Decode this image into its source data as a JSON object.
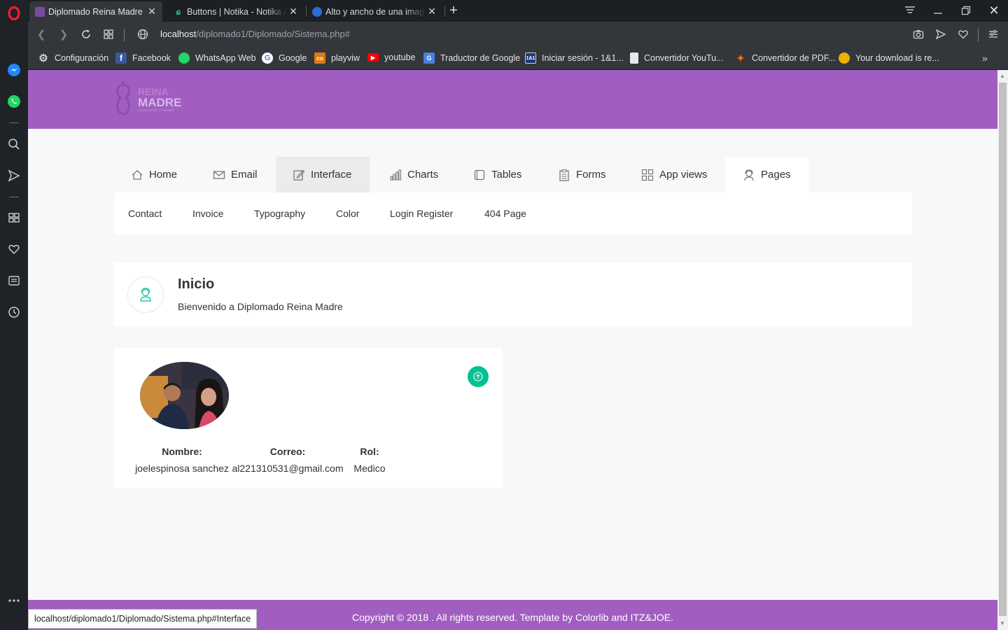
{
  "browser": {
    "tabs": [
      {
        "title": "Diplomado Reina Madre",
        "active": true
      },
      {
        "title": "Buttons | Notika - Notika Admin Template",
        "active": false
      },
      {
        "title": "Alto y ancho de una imagen",
        "active": false
      }
    ],
    "url_host": "localhost",
    "url_path": "/diplomado1/Diplomado/Sistema.php#",
    "bookmarks": [
      {
        "label": "Configuración",
        "icon": "gear-icon"
      },
      {
        "label": "Facebook",
        "icon": "facebook-icon"
      },
      {
        "label": "WhatsApp Web",
        "icon": "whatsapp-icon"
      },
      {
        "label": "Google",
        "icon": "google-icon"
      },
      {
        "label": "playviw",
        "icon": "playviw-icon"
      },
      {
        "label": "youtube",
        "icon": "youtube-icon"
      },
      {
        "label": "Traductor de Google",
        "icon": "translate-icon"
      },
      {
        "label": "Iniciar sesión - 1&1...",
        "icon": "ionos-icon"
      },
      {
        "label": "Convertidor YouTu...",
        "icon": "page-icon"
      },
      {
        "label": "Convertidor de PDF...",
        "icon": "pdf-converter-icon"
      },
      {
        "label": "Your download is re...",
        "icon": "download-icon"
      }
    ],
    "status_url": "localhost/diplomado1/Diplomado/Sistema.php#Interface"
  },
  "site": {
    "logo_top": "REINA",
    "logo_main": "MADRE",
    "logo_tag": "CLINICAS DE LA MUJER",
    "menu": [
      "Home",
      "Email",
      "Interface",
      "Charts",
      "Tables",
      "Forms",
      "App views",
      "Pages"
    ],
    "submenu": [
      "Contact",
      "Invoice",
      "Typography",
      "Color",
      "Login Register",
      "404 Page"
    ],
    "breadcrumb": {
      "title": "Inicio",
      "subtitle": "Bienvenido a Diplomado Reina Madre"
    },
    "profile": {
      "nombre_label": "Nombre:",
      "nombre": "joelespinosa sanchez",
      "correo_label": "Correo:",
      "correo": "al221310531@gmail.com",
      "rol_label": "Rol:",
      "rol": "Medico"
    },
    "footer": "Copyright © 2018 . All rights reserved. Template by Colorlib and ITZ&JOE."
  },
  "colors": {
    "header": "#a15ec0",
    "accent_green": "#00c292",
    "opera_red": "#ff1b2d"
  }
}
